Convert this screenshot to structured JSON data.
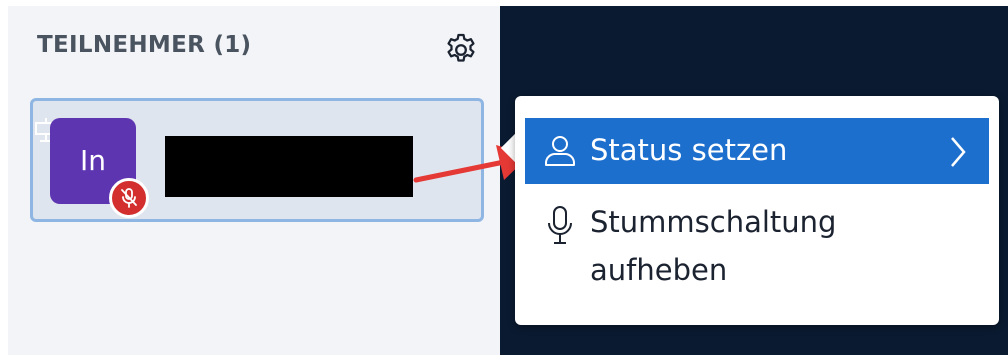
{
  "participants_panel": {
    "title": "TEILNEHMER (1)",
    "settings_icon": "gear-icon",
    "participant": {
      "avatar_initials": "In",
      "avatar_color": "#5e35b1",
      "mute_badge_color": "#d32f2f",
      "presenter_icon": "presenter-icon"
    }
  },
  "context_menu": {
    "items": [
      {
        "label": "Status setzen",
        "icon": "user-icon",
        "submenu_icon": "chevron-right-icon",
        "highlighted": true
      },
      {
        "label": "Stummschaltung aufheben",
        "icon": "mic-icon",
        "highlighted": false
      }
    ]
  },
  "colors": {
    "menu_highlight": "#1d6fce",
    "dark_background": "#0a1a30",
    "annotation_arrow": "#e53935"
  }
}
